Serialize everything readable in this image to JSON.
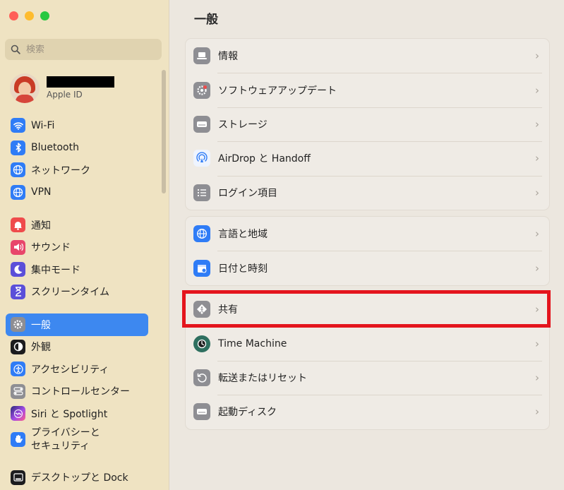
{
  "window": {
    "title": "一般"
  },
  "search": {
    "placeholder": "検索"
  },
  "account": {
    "subtitle": "Apple ID"
  },
  "sidebar": {
    "items": [
      {
        "label": "Wi-Fi",
        "icon": "wifi-icon",
        "color": "#2f7cf6"
      },
      {
        "label": "Bluetooth",
        "icon": "bluetooth-icon",
        "color": "#2f7cf6"
      },
      {
        "label": "ネットワーク",
        "icon": "globe-icon",
        "color": "#2f7cf6"
      },
      {
        "label": "VPN",
        "icon": "vpn-globe-icon",
        "color": "#2f7cf6"
      },
      {
        "label": "通知",
        "icon": "bell-icon",
        "color": "#ef4b4b"
      },
      {
        "label": "サウンド",
        "icon": "speaker-icon",
        "color": "#e8466b"
      },
      {
        "label": "集中モード",
        "icon": "moon-icon",
        "color": "#5b4fd9"
      },
      {
        "label": "スクリーンタイム",
        "icon": "hourglass-icon",
        "color": "#5b4fd9"
      },
      {
        "label": "一般",
        "icon": "gear-icon",
        "color": "#8e8e93",
        "selected": true
      },
      {
        "label": "外観",
        "icon": "appearance-icon",
        "color": "#1c1c1e"
      },
      {
        "label": "アクセシビリティ",
        "icon": "accessibility-icon",
        "color": "#2f7cf6"
      },
      {
        "label": "コントロールセンター",
        "icon": "toggles-icon",
        "color": "#8e8e93"
      },
      {
        "label": "Siri と Spotlight",
        "icon": "siri-icon",
        "color": "#a24be6"
      },
      {
        "label": "プライバシーと",
        "label2": "セキュリティ",
        "icon": "hand-icon",
        "color": "#2f7cf6"
      },
      {
        "label": "デスクトップと Dock",
        "icon": "dock-icon",
        "color": "#1c1c1e"
      }
    ]
  },
  "main": {
    "groups": [
      {
        "rows": [
          {
            "label": "情報",
            "icon": "laptop-icon",
            "color": "#8e8e93"
          },
          {
            "label": "ソフトウェアアップデート",
            "icon": "gear-badge-icon",
            "color": "#8e8e93"
          },
          {
            "label": "ストレージ",
            "icon": "drive-icon",
            "color": "#8e8e93"
          },
          {
            "label": "AirDrop と Handoff",
            "icon": "airdrop-icon",
            "color": "#eef4ff"
          },
          {
            "label": "ログイン項目",
            "icon": "list-icon",
            "color": "#8e8e93"
          }
        ]
      },
      {
        "rows": [
          {
            "label": "言語と地域",
            "icon": "globe-icon",
            "color": "#2f7cf6"
          },
          {
            "label": "日付と時刻",
            "icon": "calendar-clock-icon",
            "color": "#2f7cf6"
          }
        ]
      },
      {
        "rows": [
          {
            "label": "共有",
            "icon": "sharing-icon",
            "color": "#8e8e93"
          },
          {
            "label": "Time Machine",
            "icon": "time-machine-icon",
            "color": "#2e6f5f"
          },
          {
            "label": "転送またはリセット",
            "icon": "reset-icon",
            "color": "#8e8e93"
          },
          {
            "label": "起動ディスク",
            "icon": "startup-disk-icon",
            "color": "#8e8e93"
          }
        ]
      }
    ]
  },
  "highlight_color": "#e4151d",
  "chevron": "›"
}
